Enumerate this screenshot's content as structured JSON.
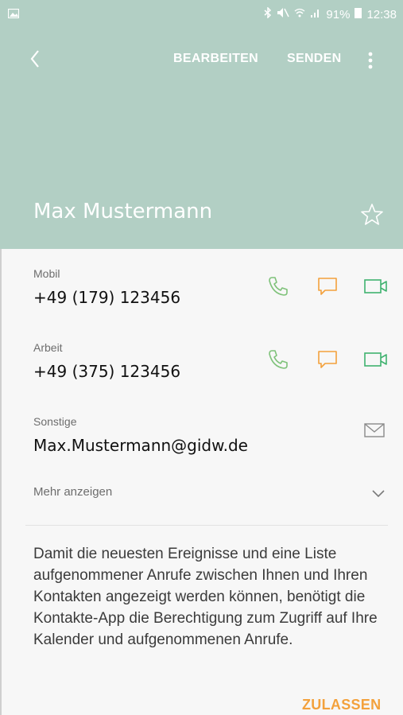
{
  "status_bar": {
    "battery": "91%",
    "time": "12:38"
  },
  "app_bar": {
    "edit_label": "BEARBEITEN",
    "send_label": "SENDEN"
  },
  "contact": {
    "name": "Max Mustermann"
  },
  "entries": [
    {
      "label": "Mobil",
      "value": "+49 (179) 123456"
    },
    {
      "label": "Arbeit",
      "value": "+49 (375) 123456"
    },
    {
      "label": "Sonstige",
      "value": "Max.Mustermann@gidw.de"
    }
  ],
  "more_label": "Mehr anzeigen",
  "notice_text": "Damit die neuesten Ereignisse und eine Liste aufgenommener Anrufe zwischen Ihnen und Ihren Kontakten angezeigt werden können, benötigt die Kontakte-App die Berechtigung zum Zugriff auf Ihre Kalender und aufgenommenen Anrufe.",
  "allow_label": "ZULASSEN",
  "colors": {
    "header": "#b2cfc4",
    "call": "#7fc27a",
    "message": "#f3a13c",
    "video": "#3fb26f"
  }
}
